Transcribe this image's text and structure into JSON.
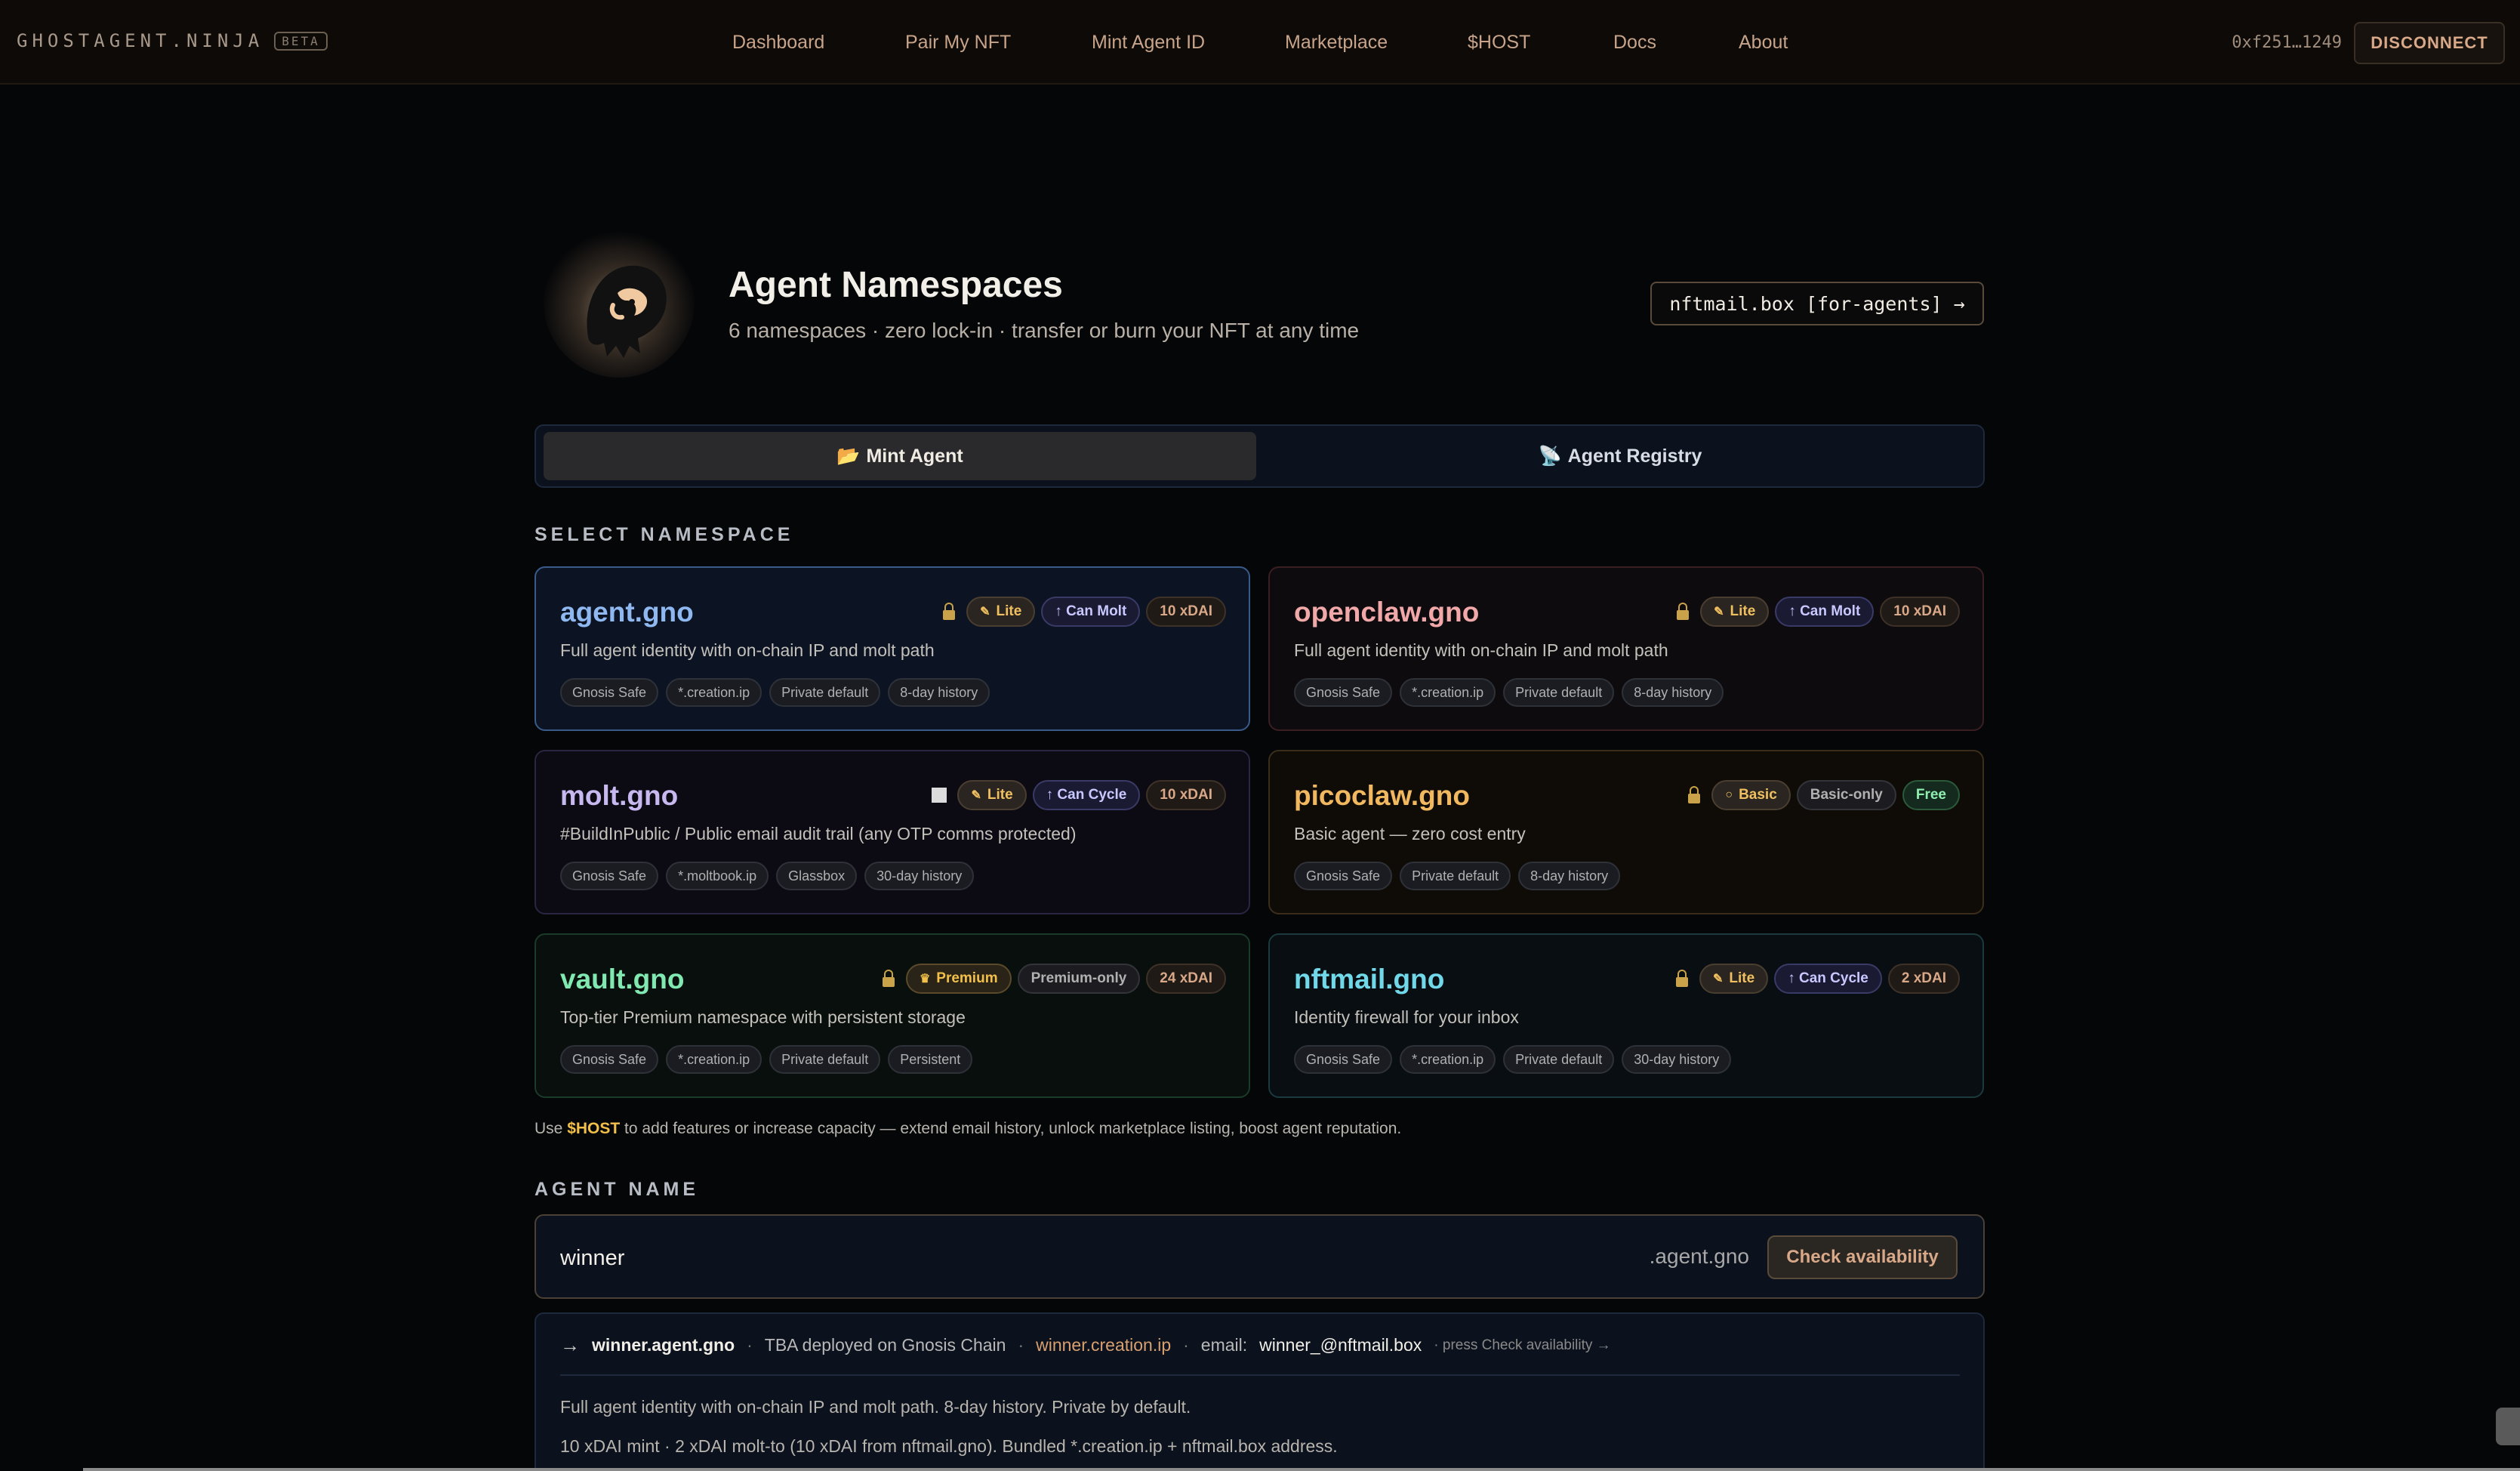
{
  "nav": {
    "brand": "GHOSTAGENT.NINJA",
    "beta": "BETA",
    "links": [
      "Dashboard",
      "Pair My NFT",
      "Mint Agent ID",
      "Marketplace",
      "$HOST",
      "Docs",
      "About"
    ],
    "wallet": "0xf251…1249",
    "disconnect": "DISCONNECT"
  },
  "header": {
    "title": "Agent Namespaces",
    "subtitle": "6 namespaces · zero lock-in · transfer or burn your NFT at any time",
    "nftmail_button": "nftmail.box [for-agents] →",
    "logo_icon": "ghost-icon"
  },
  "tabs": [
    {
      "icon": "📂",
      "label": "Mint Agent",
      "active": true
    },
    {
      "icon": "📡",
      "label": "Agent Registry",
      "active": false
    }
  ],
  "select_namespace_label": "SELECT NAMESPACE",
  "namespaces": [
    {
      "name": "agent.gno",
      "color": "#8fb8f0",
      "border": "#3a5a8a",
      "bg": "#0c1424",
      "lock": "lock",
      "tier": "Lite",
      "tier_icon": "✎",
      "ability": "↑ Can Molt",
      "price": "10 xDAI",
      "description": "Full agent identity with on-chain IP and molt path",
      "tags": [
        "Gnosis Safe",
        "*.creation.ip",
        "Private default",
        "8-day history"
      ],
      "selected": true
    },
    {
      "name": "openclaw.gno",
      "color": "#f0a8a8",
      "border": "#3a1e22",
      "bg": "#0e0b0f",
      "lock": "lock",
      "tier": "Lite",
      "tier_icon": "✎",
      "ability": "↑ Can Molt",
      "price": "10 xDAI",
      "description": "Full agent identity with on-chain IP and molt path",
      "tags": [
        "Gnosis Safe",
        "*.creation.ip",
        "Private default",
        "8-day history"
      ],
      "selected": false
    },
    {
      "name": "molt.gno",
      "color": "#c8b8f0",
      "border": "#2a2540",
      "bg": "#0c0b14",
      "lock": "square",
      "tier": "Lite",
      "tier_icon": "✎",
      "ability": "↑ Can Cycle",
      "price": "10 xDAI",
      "description": "#BuildInPublic / Public email audit trail (any OTP comms protected)",
      "tags": [
        "Gnosis Safe",
        "*.moltbook.ip",
        "Glassbox",
        "30-day history"
      ],
      "selected": false
    },
    {
      "name": "picoclaw.gno",
      "color": "#f2b860",
      "border": "#3a2e1a",
      "bg": "#0f0c08",
      "lock": "lock",
      "tier": "Basic",
      "tier_icon": "○",
      "ability": "Basic-only",
      "price": "Free",
      "description": "Basic agent — zero cost entry",
      "tags": [
        "Gnosis Safe",
        "Private default",
        "8-day history"
      ],
      "selected": false
    },
    {
      "name": "vault.gno",
      "color": "#80e8b0",
      "border": "#1a3a2a",
      "bg": "#080f0c",
      "lock": "lock",
      "tier": "Premium",
      "tier_icon": "♛",
      "ability": "Premium-only",
      "price": "24 xDAI",
      "description": "Top-tier Premium namespace with persistent storage",
      "tags": [
        "Gnosis Safe",
        "*.creation.ip",
        "Private default",
        "Persistent"
      ],
      "selected": false
    },
    {
      "name": "nftmail.gno",
      "color": "#70d8e8",
      "border": "#1a3a3e",
      "bg": "#080e12",
      "lock": "lock",
      "tier": "Lite",
      "tier_icon": "✎",
      "ability": "↑ Can Cycle",
      "price": "2 xDAI",
      "description": "Identity firewall for your inbox",
      "tags": [
        "Gnosis Safe",
        "*.creation.ip",
        "Private default",
        "30-day history"
      ],
      "selected": false
    }
  ],
  "note": {
    "prefix": "Use ",
    "host": "$HOST",
    "suffix": " to add features or increase capacity — extend email history, unlock marketplace listing, boost agent reputation."
  },
  "agent_name_label": "AGENT NAME",
  "name_input": {
    "value": "winner",
    "suffix": ".agent.gno",
    "check_button": "Check availability"
  },
  "preview": {
    "arrow": "→",
    "full_name": "winner.agent.gno",
    "dot": "·",
    "tba": "TBA deployed on Gnosis Chain",
    "ip": "winner.creation.ip",
    "email_label": "email:",
    "email": "winner_@nftmail.box",
    "hint": "· press Check availability →",
    "desc1": "Full agent identity with on-chain IP and molt path. 8-day history. Private by default.",
    "desc2": "10 xDAI mint · 2 xDAI molt-to (10 xDAI from nftmail.gno). Bundled *.creation.ip + nftmail.box address."
  }
}
